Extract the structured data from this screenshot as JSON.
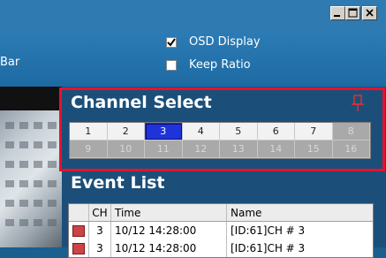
{
  "window_controls": [
    "minimize-icon",
    "maximize-icon",
    "close-icon"
  ],
  "toolbar": {
    "cut_label": "Bar",
    "osd_display": {
      "label": "OSD Display",
      "checked": true
    },
    "keep_ratio": {
      "label": "Keep Ratio",
      "checked": false
    }
  },
  "channel_select": {
    "title": "Channel Select",
    "pin_icon": "pin-icon",
    "channels": [
      {
        "label": "1",
        "state": "normal"
      },
      {
        "label": "2",
        "state": "normal"
      },
      {
        "label": "3",
        "state": "selected"
      },
      {
        "label": "4",
        "state": "normal"
      },
      {
        "label": "5",
        "state": "normal"
      },
      {
        "label": "6",
        "state": "normal"
      },
      {
        "label": "7",
        "state": "normal"
      },
      {
        "label": "8",
        "state": "disabled"
      },
      {
        "label": "9",
        "state": "disabled"
      },
      {
        "label": "10",
        "state": "disabled"
      },
      {
        "label": "11",
        "state": "disabled"
      },
      {
        "label": "12",
        "state": "disabled"
      },
      {
        "label": "13",
        "state": "disabled"
      },
      {
        "label": "14",
        "state": "disabled"
      },
      {
        "label": "15",
        "state": "disabled"
      },
      {
        "label": "16",
        "state": "disabled"
      }
    ]
  },
  "event_list": {
    "title": "Event List",
    "columns": [
      "CH",
      "Time",
      "Name"
    ],
    "rows": [
      {
        "ch": "3",
        "time": "10/12 14:28:00",
        "name": "[ID:61]CH # 3"
      },
      {
        "ch": "3",
        "time": "10/12 14:28:00",
        "name": "[ID:61]CH # 3"
      }
    ]
  },
  "colors": {
    "accent_highlight": "#e8112d",
    "selected_channel": "#1f34d8"
  }
}
